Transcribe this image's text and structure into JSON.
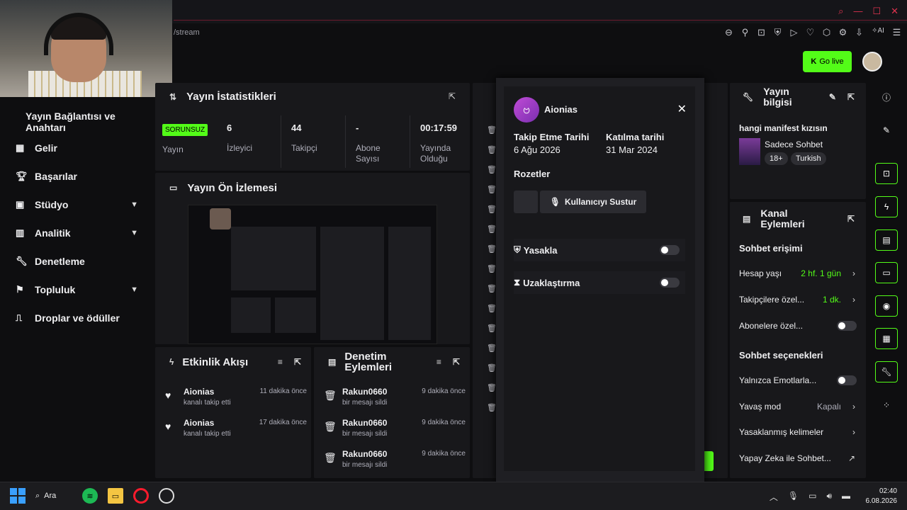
{
  "browser": {
    "url": "/stream",
    "icons": [
      "zoom-icon",
      "pin-icon",
      "screenshot-icon",
      "shield-icon",
      "play-icon",
      "heart-icon",
      "cube-icon",
      "extension-icon",
      "download-icon",
      "ai-icon",
      "menu-icon"
    ],
    "ai_label": "AI"
  },
  "header": {
    "go_live": "Go live"
  },
  "sidebar": {
    "title": "Yayın Bağlantısı ve Anahtarı",
    "items": [
      {
        "label": "Gelir",
        "icon": "chart-icon"
      },
      {
        "label": "Başarılar",
        "icon": "trophy-icon"
      },
      {
        "label": "Stüdyo",
        "icon": "studio-icon",
        "expand": true
      },
      {
        "label": "Analitik",
        "icon": "analytics-icon",
        "expand": true
      },
      {
        "label": "Denetleme",
        "icon": "wrench-icon"
      },
      {
        "label": "Topluluk",
        "icon": "community-icon",
        "expand": true
      },
      {
        "label": "Droplar ve ödüller",
        "icon": "gift-icon"
      }
    ]
  },
  "stats": {
    "title": "Yayın İstatistikleri",
    "status": "SORUNSUZ",
    "status_label": "Yayın",
    "cells": [
      {
        "value": "6",
        "label": "İzleyici"
      },
      {
        "value": "44",
        "label": "Takipçi"
      },
      {
        "value": "-",
        "label": "Abone Sayısı"
      },
      {
        "value": "00:17:59",
        "label": "Yayında Olduğu Süre"
      }
    ]
  },
  "preview": {
    "title": "Yayın Ön İzlemesi"
  },
  "events": {
    "title": "Etkinlik Akışı",
    "items": [
      {
        "name": "Aionias",
        "desc": "kanalı takip etti",
        "time": "11 dakika önce"
      },
      {
        "name": "Aionias",
        "desc": "kanalı takip etti",
        "time": "17 dakika önce"
      }
    ]
  },
  "moderation": {
    "title": "Denetim Eylemleri",
    "items": [
      {
        "name": "Rakun0660",
        "desc": "bir mesajı sildi",
        "time": "9 dakika önce"
      },
      {
        "name": "Rakun0660",
        "desc": "bir mesajı sildi",
        "time": "9 dakika önce"
      },
      {
        "name": "Rakun0660",
        "desc": "bir mesajı sildi",
        "time": "9 dakika önce"
      }
    ]
  },
  "user_popup": {
    "username": "Aionias",
    "follow_label": "Takip Etme Tarihi",
    "follow_date": "6 Ağu 2026",
    "join_label": "Katılma tarihi",
    "join_date": "31 Mar 2024",
    "badges_label": "Rozetler",
    "mute_button": "Kullanıcıyı Sustur",
    "ban_label": "Yasakla",
    "timeout_label": "Uzaklaştırma",
    "ban_on": false,
    "timeout_on": false
  },
  "stream_info": {
    "title": "Yayın bilgisi",
    "stream_title": "hangi manifest kızısın",
    "category": "Sadece Sohbet",
    "tags": [
      "18+",
      "Turkish"
    ]
  },
  "channel_actions": {
    "title": "Kanal Eylemleri",
    "chat_access": "Sohbet erişimi",
    "account_age_label": "Hesap yaşı",
    "account_age_value": "2 hf. 1 gün",
    "followers_only_label": "Takipçilere özel...",
    "followers_only_value": "1 dk.",
    "subs_only_label": "Abonelere özel...",
    "chat_options": "Sohbet seçenekleri",
    "emotes_only_label": "Yalnızca Emotlarla...",
    "slow_mode_label": "Yavaş mod",
    "slow_mode_value": "Kapalı",
    "banned_words_label": "Yasaklanmış kelimeler",
    "ai_chat_label": "Yapay Zeka ile Sohbet..."
  },
  "taskbar": {
    "search": "Ara",
    "time": "02:40",
    "date": "6.08.2026"
  }
}
